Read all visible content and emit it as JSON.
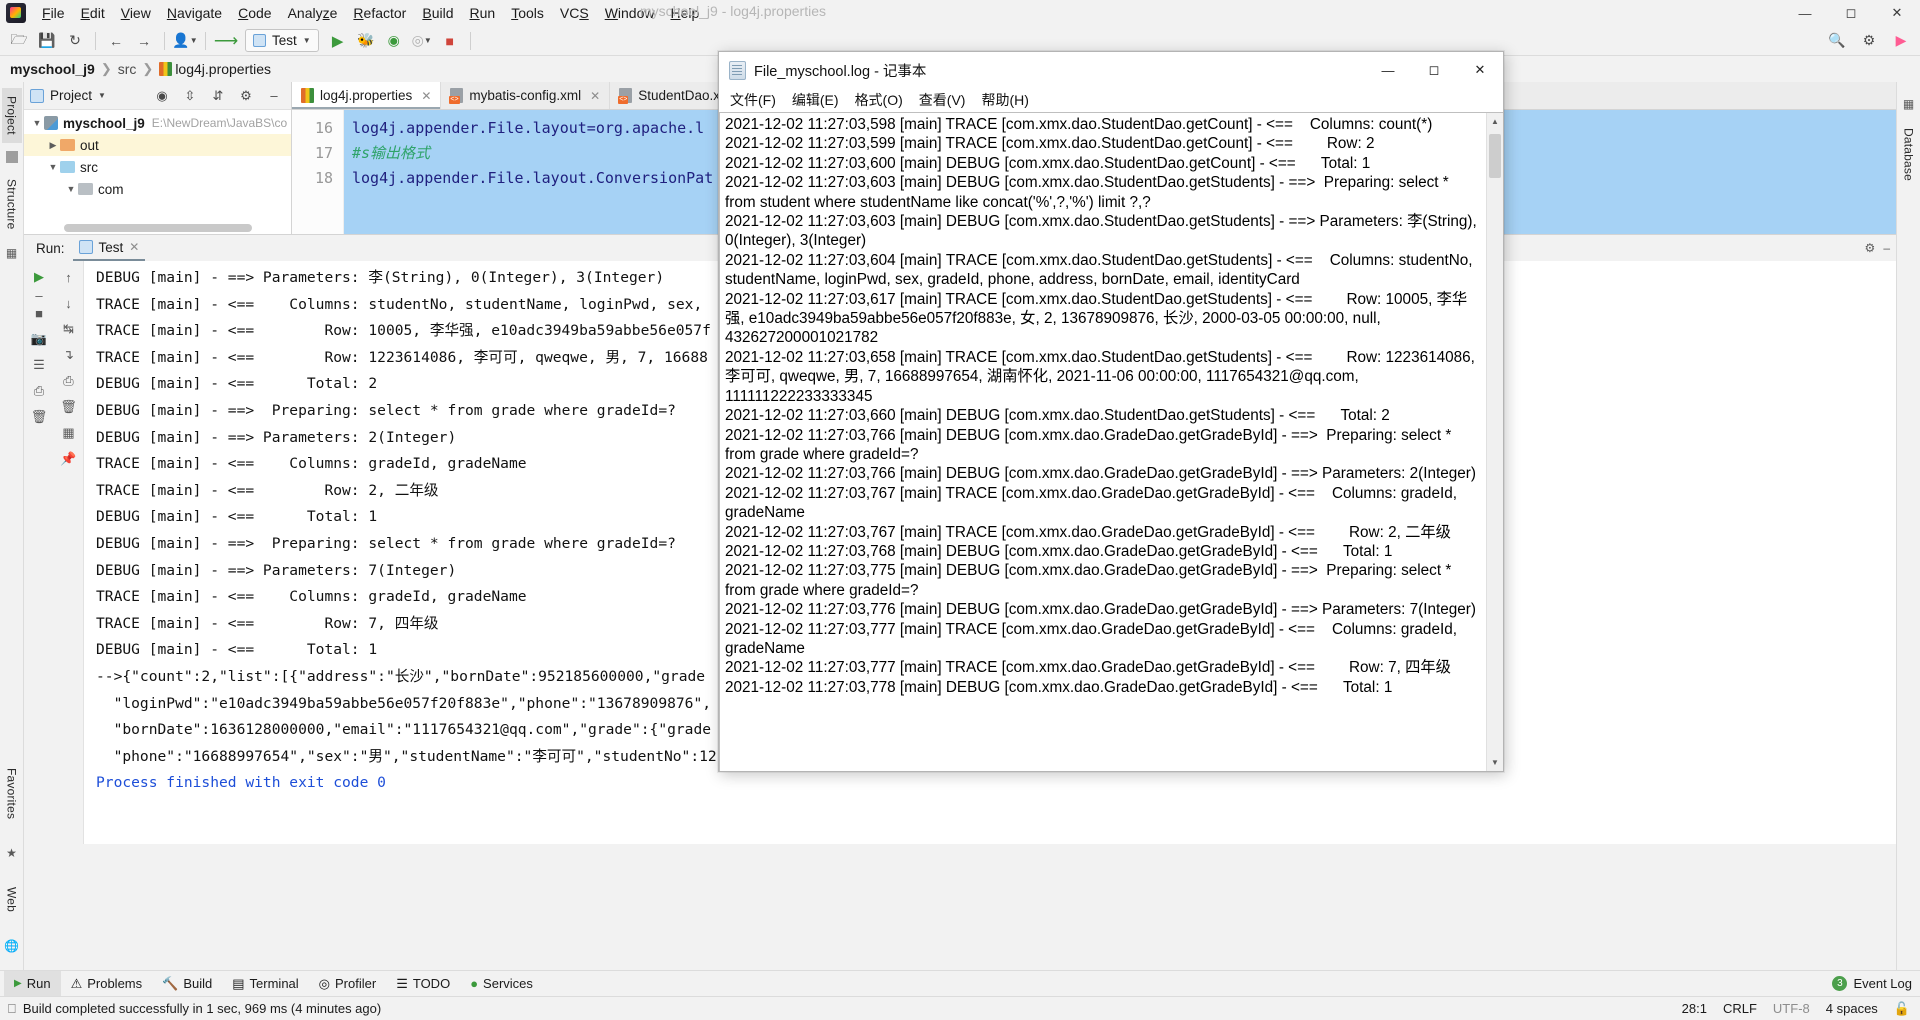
{
  "app": {
    "window_title": "myschool_j9 - log4j.properties",
    "menu": [
      "File",
      "Edit",
      "View",
      "Navigate",
      "Code",
      "Analyze",
      "Refactor",
      "Build",
      "Run",
      "Tools",
      "VCS",
      "Window",
      "Help"
    ],
    "window_buttons": [
      "minimize",
      "maximize",
      "close"
    ]
  },
  "toolbar": {
    "run_config": "Test",
    "icons": [
      "open-folder-icon",
      "save-icon",
      "sync-icon",
      "back-arrow-icon",
      "forward-arrow-icon",
      "user-icon",
      "update-icon",
      "run-icon",
      "debug-icon",
      "run-coverage-icon",
      "profile-icon",
      "stop-icon"
    ],
    "right_icons": [
      "search-icon",
      "settings-icon",
      "ide-icon"
    ]
  },
  "breadcrumb": {
    "project": "myschool_j9",
    "folder": "src",
    "file": "log4j.properties"
  },
  "left_rail": [
    "Project",
    "Structure"
  ],
  "right_rail": [
    "Database"
  ],
  "bottom_left_rail": [
    "Favorites",
    "Web"
  ],
  "project_panel": {
    "title": "Project",
    "header_icons": [
      "locate-icon",
      "expand-all-icon",
      "collapse-all-icon",
      "settings-icon",
      "hide-icon"
    ],
    "tree": [
      {
        "label": "myschool_j9",
        "path": "E:\\NewDream\\JavaBS\\co",
        "kind": "module",
        "expanded": true,
        "indent": 0
      },
      {
        "label": "out",
        "path": "",
        "kind": "folder-orange",
        "expanded": false,
        "indent": 1
      },
      {
        "label": "src",
        "path": "",
        "kind": "folder-blue",
        "expanded": true,
        "indent": 1
      },
      {
        "label": "com",
        "path": "",
        "kind": "folder-gray",
        "expanded": true,
        "indent": 2
      }
    ]
  },
  "editor": {
    "tabs": [
      {
        "label": "log4j.properties",
        "icon": "properties-file-icon",
        "active": true
      },
      {
        "label": "mybatis-config.xml",
        "icon": "xml-file-icon",
        "active": false
      },
      {
        "label": "StudentDao.xm",
        "icon": "xml-file-icon",
        "active": false
      }
    ],
    "line_numbers": [
      "16",
      "17",
      "18"
    ],
    "lines": [
      {
        "text": "log4j.appender.File.layout=org.apache.l",
        "type": "code"
      },
      {
        "text": "#s输出格式",
        "type": "comment"
      },
      {
        "text": "log4j.appender.File.layout.ConversionPat",
        "type": "code"
      }
    ]
  },
  "run_window": {
    "label": "Run:",
    "tab": "Test",
    "rail_icons": [
      "rerun-icon",
      "up-arrow-icon",
      "down-arrow-icon",
      "stop-icon",
      "camera-icon",
      "soft-wrap-icon",
      "scroll-to-end-icon",
      "print-icon",
      "trash-icon",
      "pin-icon"
    ],
    "console_lines": [
      "DEBUG [main] - ==> Parameters: 李(String), 0(Integer), 3(Integer)",
      "TRACE [main] - <==    Columns: studentNo, studentName, loginPwd, sex,",
      "TRACE [main] - <==        Row: 10005, 李华强, e10adc3949ba59abbe56e057f",
      "TRACE [main] - <==        Row: 1223614086, 李可可, qweqwe, 男, 7, 16688",
      "DEBUG [main] - <==      Total: 2",
      "DEBUG [main] - ==>  Preparing: select * from grade where gradeId=?",
      "DEBUG [main] - ==> Parameters: 2(Integer)",
      "TRACE [main] - <==    Columns: gradeId, gradeName",
      "TRACE [main] - <==        Row: 2, 二年级",
      "DEBUG [main] - <==      Total: 1",
      "DEBUG [main] - ==>  Preparing: select * from grade where gradeId=?",
      "DEBUG [main] - ==> Parameters: 7(Integer)",
      "TRACE [main] - <==    Columns: gradeId, gradeName",
      "TRACE [main] - <==        Row: 7, 四年级",
      "DEBUG [main] - <==      Total: 1",
      "-->{\"count\":2,\"list\":[{\"address\":\"长沙\",\"bornDate\":952185600000,\"grade",
      "  \"loginPwd\":\"e10adc3949ba59abbe56e057f20f883e\",\"phone\":\"13678909876\",",
      "  \"bornDate\":1636128000000,\"email\":\"1117654321@qq.com\",\"grade\":{\"grade",
      "  \"phone\":\"16688997654\",\"sex\":\"男\",\"studentName\":\"李可可\",\"studentNo\":12",
      "",
      "Process finished with exit code 0"
    ],
    "exit_line_index": 20
  },
  "bottom_tabs": [
    {
      "label": "Run",
      "icon": "run-icon",
      "selected": true
    },
    {
      "label": "Problems",
      "icon": "problems-icon",
      "selected": false
    },
    {
      "label": "Build",
      "icon": "build-icon",
      "selected": false
    },
    {
      "label": "Terminal",
      "icon": "terminal-icon",
      "selected": false
    },
    {
      "label": "Profiler",
      "icon": "profiler-icon",
      "selected": false
    },
    {
      "label": "TODO",
      "icon": "todo-icon",
      "selected": false
    },
    {
      "label": "Services",
      "icon": "services-icon",
      "selected": false
    }
  ],
  "event_log": {
    "label": "Event Log",
    "count": "3"
  },
  "status_bar": {
    "message": "Build completed successfully in 1 sec, 969 ms (4 minutes ago)",
    "caret": "28:1",
    "line_sep": "CRLF",
    "encoding": "UTF-8",
    "indent": "4 spaces"
  },
  "notepad": {
    "title": "File_myschool.log - 记事本",
    "menu": [
      "文件(F)",
      "编辑(E)",
      "格式(O)",
      "查看(V)",
      "帮助(H)"
    ],
    "window_buttons": [
      "minimize",
      "maximize",
      "close"
    ],
    "content": "2021-12-02 11:27:03,598 [main] TRACE [com.xmx.dao.StudentDao.getCount] - <==    Columns: count(*)\n2021-12-02 11:27:03,599 [main] TRACE [com.xmx.dao.StudentDao.getCount] - <==        Row: 2\n2021-12-02 11:27:03,600 [main] DEBUG [com.xmx.dao.StudentDao.getCount] - <==      Total: 1\n2021-12-02 11:27:03,603 [main] DEBUG [com.xmx.dao.StudentDao.getStudents] - ==>  Preparing: select * from student where studentName like concat('%',?,'%') limit ?,?\n2021-12-02 11:27:03,603 [main] DEBUG [com.xmx.dao.StudentDao.getStudents] - ==> Parameters: 李(String), 0(Integer), 3(Integer)\n2021-12-02 11:27:03,604 [main] TRACE [com.xmx.dao.StudentDao.getStudents] - <==    Columns: studentNo, studentName, loginPwd, sex, gradeId, phone, address, bornDate, email, identityCard\n2021-12-02 11:27:03,617 [main] TRACE [com.xmx.dao.StudentDao.getStudents] - <==        Row: 10005, 李华强, e10adc3949ba59abbe56e057f20f883e, 女, 2, 13678909876, 长沙, 2000-03-05 00:00:00, null, 432627200001021782\n2021-12-02 11:27:03,658 [main] TRACE [com.xmx.dao.StudentDao.getStudents] - <==        Row: 1223614086, 李可可, qweqwe, 男, 7, 16688997654, 湖南怀化, 2021-11-06 00:00:00, 1117654321@qq.com, 111111222233333345\n2021-12-02 11:27:03,660 [main] DEBUG [com.xmx.dao.StudentDao.getStudents] - <==      Total: 2\n2021-12-02 11:27:03,766 [main] DEBUG [com.xmx.dao.GradeDao.getGradeById] - ==>  Preparing: select * from grade where gradeId=?\n2021-12-02 11:27:03,766 [main] DEBUG [com.xmx.dao.GradeDao.getGradeById] - ==> Parameters: 2(Integer)\n2021-12-02 11:27:03,767 [main] TRACE [com.xmx.dao.GradeDao.getGradeById] - <==    Columns: gradeId, gradeName\n2021-12-02 11:27:03,767 [main] TRACE [com.xmx.dao.GradeDao.getGradeById] - <==        Row: 2, 二年级\n2021-12-02 11:27:03,768 [main] DEBUG [com.xmx.dao.GradeDao.getGradeById] - <==      Total: 1\n2021-12-02 11:27:03,775 [main] DEBUG [com.xmx.dao.GradeDao.getGradeById] - ==>  Preparing: select * from grade where gradeId=?\n2021-12-02 11:27:03,776 [main] DEBUG [com.xmx.dao.GradeDao.getGradeById] - ==> Parameters: 7(Integer)\n2021-12-02 11:27:03,777 [main] TRACE [com.xmx.dao.GradeDao.getGradeById] - <==    Columns: gradeId, gradeName\n2021-12-02 11:27:03,777 [main] TRACE [com.xmx.dao.GradeDao.getGradeById] - <==        Row: 7, 四年级\n2021-12-02 11:27:03,778 [main] DEBUG [com.xmx.dao.GradeDao.getGradeById] - <==      Total: 1"
  }
}
